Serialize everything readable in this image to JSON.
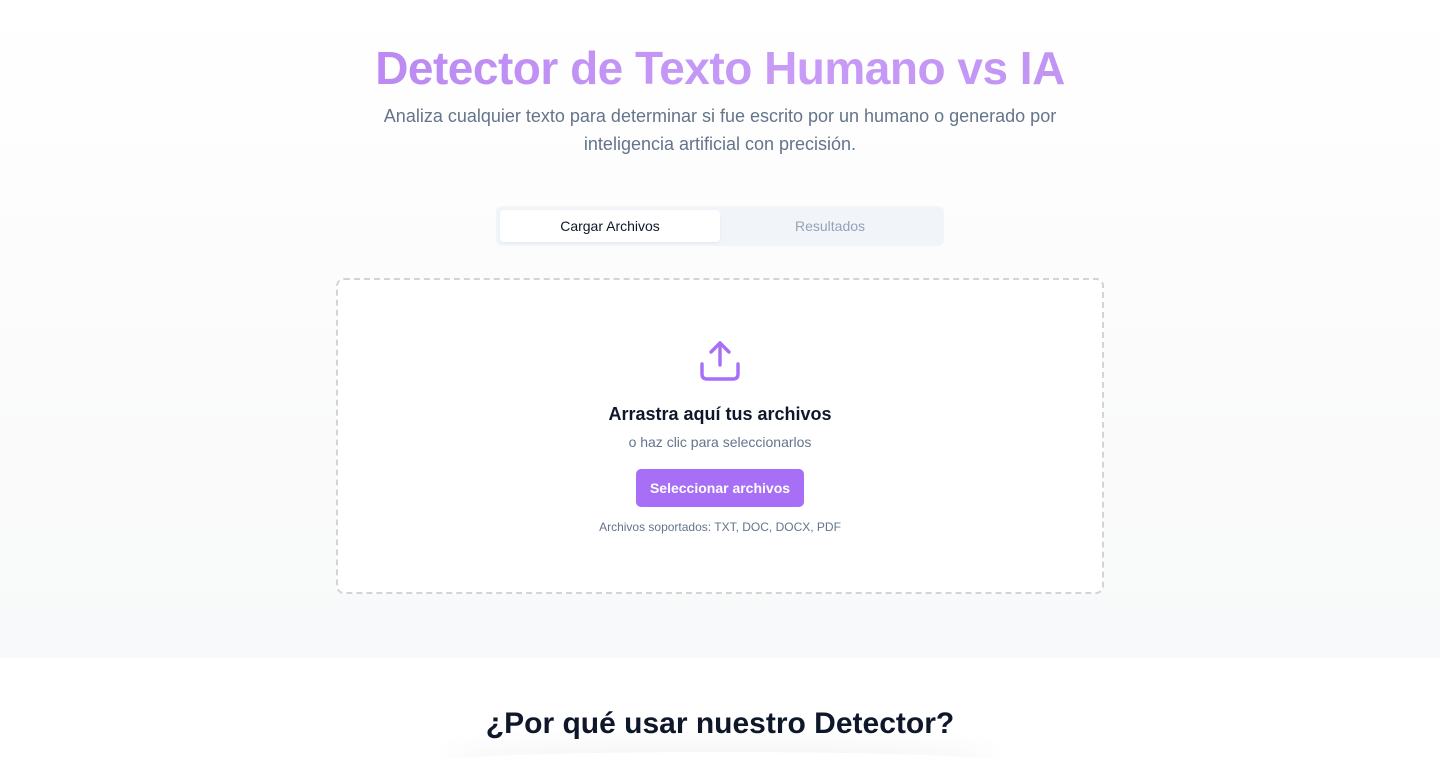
{
  "header": {
    "title": "Detector de Texto Humano vs IA",
    "subtitle": "Analiza cualquier texto para determinar si fue escrito por un humano o generado por inteligencia artificial con precisión."
  },
  "tabs": [
    {
      "label": "Cargar Archivos",
      "active": true
    },
    {
      "label": "Resultados",
      "active": false
    }
  ],
  "upload": {
    "icon": "upload-icon",
    "title": "Arrastra aquí tus archivos",
    "subtitle": "o haz clic para seleccionarlos",
    "button_label": "Seleccionar archivos",
    "supported": "Archivos soportados: TXT, DOC, DOCX, PDF"
  },
  "features": {
    "title": "¿Por qué usar nuestro Detector?"
  },
  "colors": {
    "accent": "#a66ff5",
    "title_gradient_start": "#b07bef",
    "title_gradient_end": "#c89bf6"
  }
}
